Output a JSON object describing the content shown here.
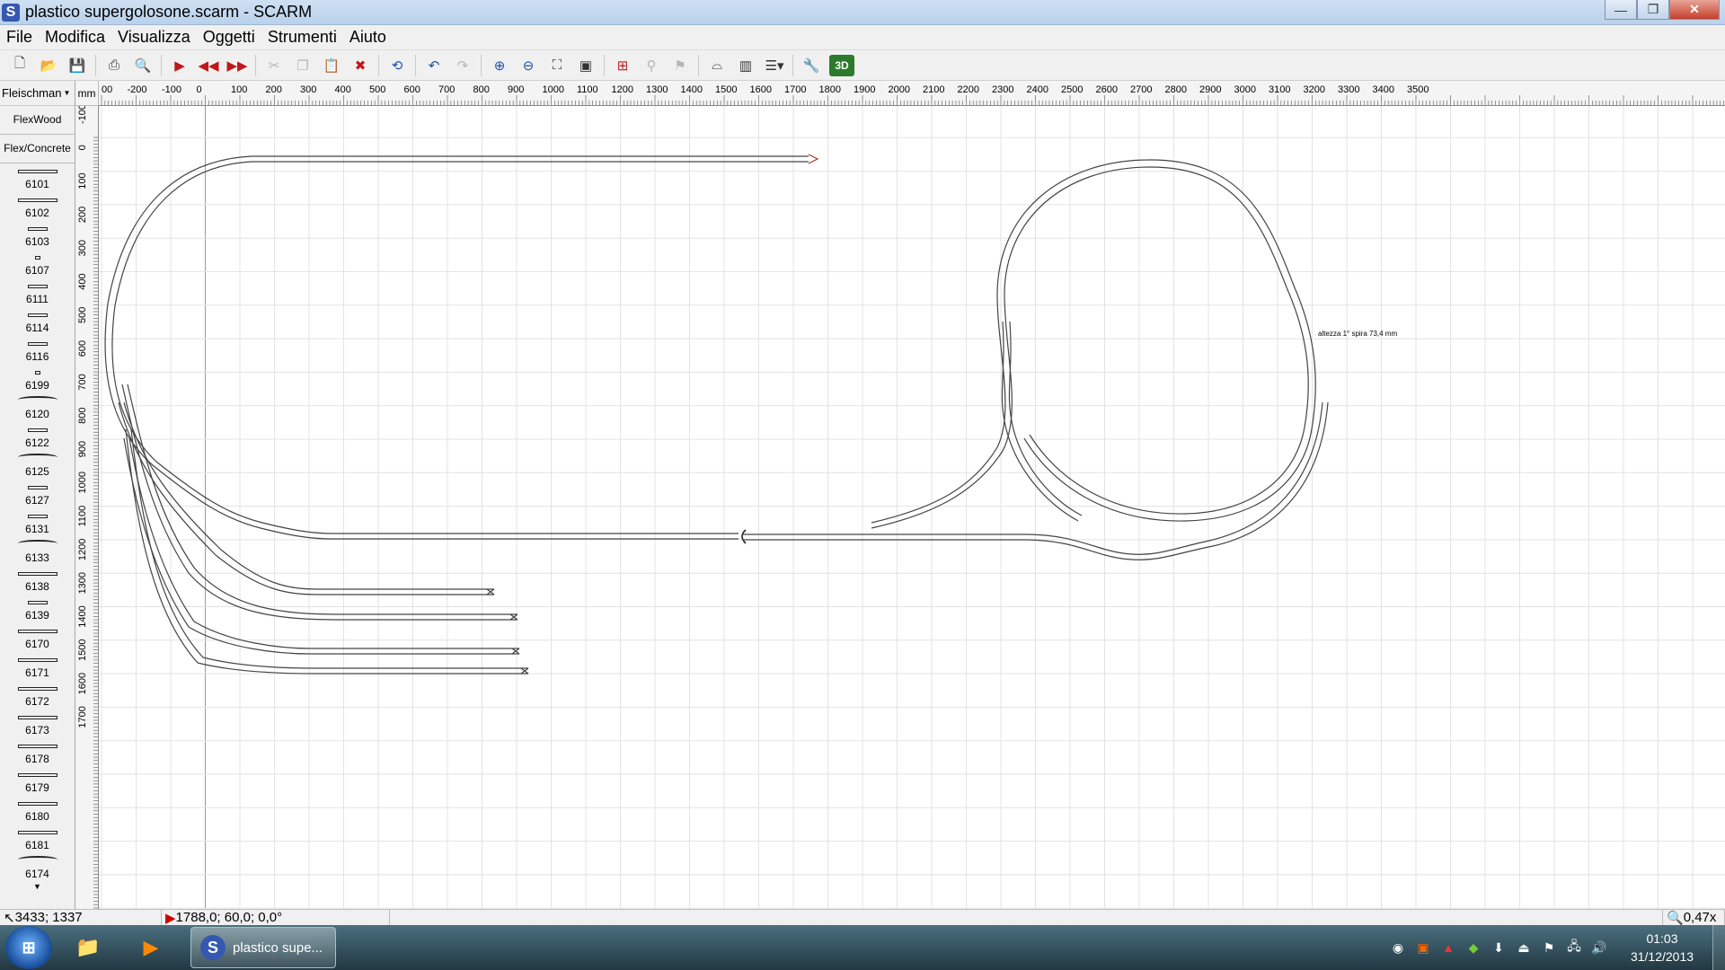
{
  "window": {
    "app_icon": "S",
    "title": "plastico supergolosone.scarm - SCARM",
    "min_label": "—",
    "max_label": "❐",
    "close_label": "✕"
  },
  "menu": [
    "File",
    "Modifica",
    "Visualizza",
    "Oggetti",
    "Strumenti",
    "Aiuto"
  ],
  "toolbar": {
    "icons": [
      "new-file-icon",
      "open-folder-icon",
      "save-icon",
      "print-icon",
      "print-preview-icon",
      "run-icon",
      "step-back-icon",
      "step-forward-icon",
      "cut-icon",
      "copy-icon",
      "paste-icon",
      "delete-icon",
      "rotate-icon",
      "undo-icon",
      "redo-icon",
      "zoom-in-icon",
      "zoom-out-icon",
      "zoom-fit-icon",
      "zoom-actual-icon",
      "track-tool-icon",
      "flex-icon",
      "height-icon",
      "bridge-icon",
      "tunnel-icon",
      "layers-icon",
      "settings-icon",
      "view-3d-icon"
    ],
    "label_3d": "3D"
  },
  "palette": {
    "library": "Fleischman",
    "categories": [
      "FlexWood",
      "Flex/Concrete"
    ],
    "items": [
      "6101",
      "6102",
      "6103",
      "6107",
      "6111",
      "6114",
      "6116",
      "6199",
      "6120",
      "6122",
      "6125",
      "6127",
      "6131",
      "6133",
      "6138",
      "6139",
      "6170",
      "6171",
      "6172",
      "6173",
      "6178",
      "6179",
      "6180",
      "6181",
      "6174"
    ]
  },
  "ruler": {
    "unit": "mm",
    "h_ticks": [
      "00",
      "-200",
      "-100",
      "0",
      "100",
      "200",
      "300",
      "400",
      "500",
      "600",
      "700",
      "800",
      "900",
      "1000",
      "1100",
      "1200",
      "1300",
      "1400",
      "1500",
      "1600",
      "1700",
      "1800",
      "1900",
      "2000",
      "2100",
      "2200",
      "2300",
      "2400",
      "2500",
      "2600",
      "2700",
      "2800",
      "2900",
      "3000",
      "3100",
      "3200",
      "3300",
      "3400",
      "3500"
    ],
    "v_ticks": [
      "-100",
      "0",
      "100",
      "200",
      "300",
      "400",
      "500",
      "600",
      "700",
      "800",
      "900",
      "1000",
      "1100",
      "1200",
      "1300",
      "1400",
      "1500",
      "1600",
      "1700"
    ]
  },
  "canvas": {
    "annotation": "altezza 1° spira 73,4 mm"
  },
  "status": {
    "cursor": "3433; 1337",
    "selection": "1788,0; 60,0; 0,0°",
    "zoom": "0,47x"
  },
  "taskbar": {
    "active_app": "plastico supe...",
    "active_icon": "S",
    "time": "01:03",
    "date": "31/12/2013"
  }
}
